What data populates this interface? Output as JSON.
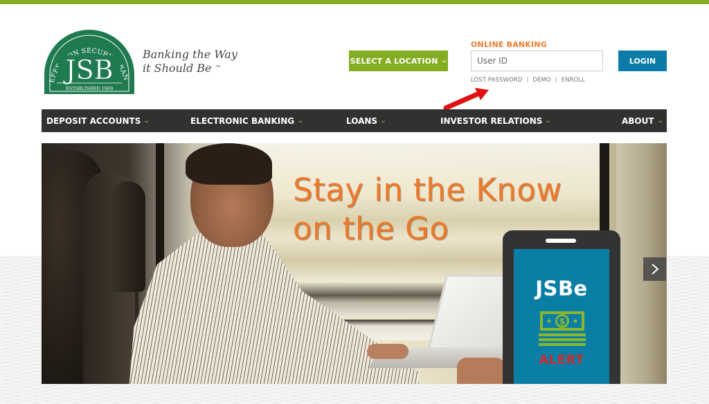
{
  "brand": {
    "logo": {
      "arc_text": "JEFFERSON SECURITY BANK",
      "monogram": "JSB",
      "established": "ESTABLISHED 1869"
    },
    "tagline_line1": "Banking the Way",
    "tagline_line2": "it Should Be",
    "trademark": "™"
  },
  "location_select": {
    "label": "SELECT A LOCATION",
    "icon": "chevron-down-icon"
  },
  "online_banking": {
    "heading": "ONLINE BANKING",
    "user_id": {
      "value": "",
      "placeholder": "User ID"
    },
    "login_label": "LOGIN",
    "links": [
      {
        "label": "LOST PASSWORD"
      },
      {
        "label": "DEMO"
      },
      {
        "label": "ENROLL"
      }
    ],
    "separator": "|"
  },
  "nav": {
    "items": [
      {
        "label": "DEPOSIT ACCOUNTS",
        "icon": "chevron-down-icon"
      },
      {
        "label": "ELECTRONIC BANKING",
        "icon": "chevron-down-icon"
      },
      {
        "label": "LOANS",
        "icon": "chevron-down-icon"
      },
      {
        "label": "INVESTOR RELATIONS",
        "icon": "chevron-down-icon"
      },
      {
        "label": "ABOUT",
        "icon": "chevron-down-icon"
      }
    ]
  },
  "hero": {
    "headline_line1": "Stay in the Know",
    "headline_line2": "on the Go",
    "phone": {
      "app_name": "JSBe",
      "icon": "money-icon",
      "badge": "ALERT"
    },
    "next_icon": "chevron-right-icon"
  },
  "colors": {
    "brand_green": "#84ad22",
    "logo_green": "#1f7a4f",
    "accent_orange": "#ec7a2a",
    "login_blue": "#0b7ba8",
    "nav_dark": "#313131",
    "alert_red": "#d12a2a"
  }
}
